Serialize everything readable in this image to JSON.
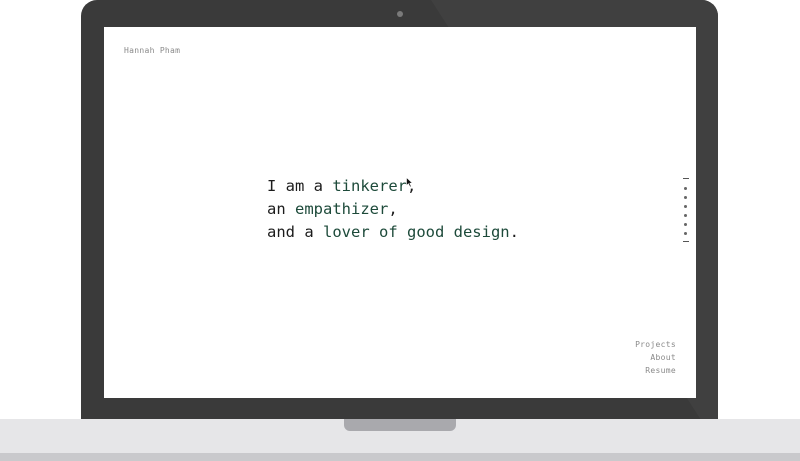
{
  "site": {
    "owner_name": "Hannah Pham"
  },
  "hero": {
    "line1_prefix": "I am a ",
    "line1_highlight": "tinkerer",
    "line1_suffix": ",",
    "line2_prefix": "an ",
    "line2_highlight": "empathizer",
    "line2_suffix": ",",
    "line3_prefix": "and a ",
    "line3_highlight": "lover of good design",
    "line3_suffix": "."
  },
  "nav": {
    "links": [
      "Projects",
      "About",
      "Resume"
    ]
  },
  "scroll_indicator": {
    "section_count": 6
  },
  "colors": {
    "laptop_frame": "#3a3a3a",
    "laptop_base": "#e6e6e8",
    "screen_bg": "#ffffff",
    "text_primary": "#1c1c1c",
    "text_highlight": "#1d4a3a",
    "text_muted": "#8a8a8a"
  },
  "icons": {
    "camera": "camera-icon",
    "cursor": "mouse-pointer-icon"
  }
}
